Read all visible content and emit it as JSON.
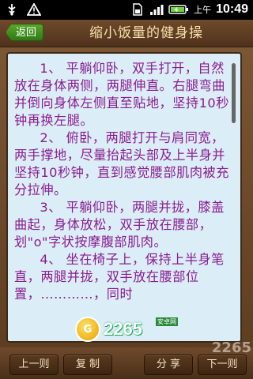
{
  "status_bar": {
    "time": "10:49",
    "ampm": "上午",
    "left_icons": [
      "usb-icon",
      "warning-icon"
    ],
    "right_icons": [
      "sim-icon",
      "signal-icon",
      "battery-icon"
    ]
  },
  "header": {
    "back_label": "返回",
    "title": "缩小饭量的健身操"
  },
  "article": {
    "paragraphs": [
      "1、 平躺仰卧，双手打开，自然放在身体两侧，两腿伸直。右腿弯曲并倒向身体左侧直至贴地，坚持10秒钟再换左腿。",
      "2、 俯卧，两腿打开与肩同宽，两手撑地，尽量抬起头部及上半身并坚持10秒钟，直到感觉腰部肌肉被充分拉伸。",
      "3、 平躺仰卧，两腿并拢，膝盖曲起，身体放松，双手放在腰部，划\"o\"字状按摩腹部肌肉。",
      "4、 坐在椅子上，保持上半身笔直，两腿并拢，双手放在腰部位置，…………，同时"
    ]
  },
  "watermark": {
    "badge": "G",
    "text": "2265",
    "sub": "安卓网",
    "corner": "2265"
  },
  "bottom_bar": {
    "prev_label": "上一则",
    "copy_label": "复 制",
    "share_label": "分 享",
    "next_label": "下一则"
  }
}
